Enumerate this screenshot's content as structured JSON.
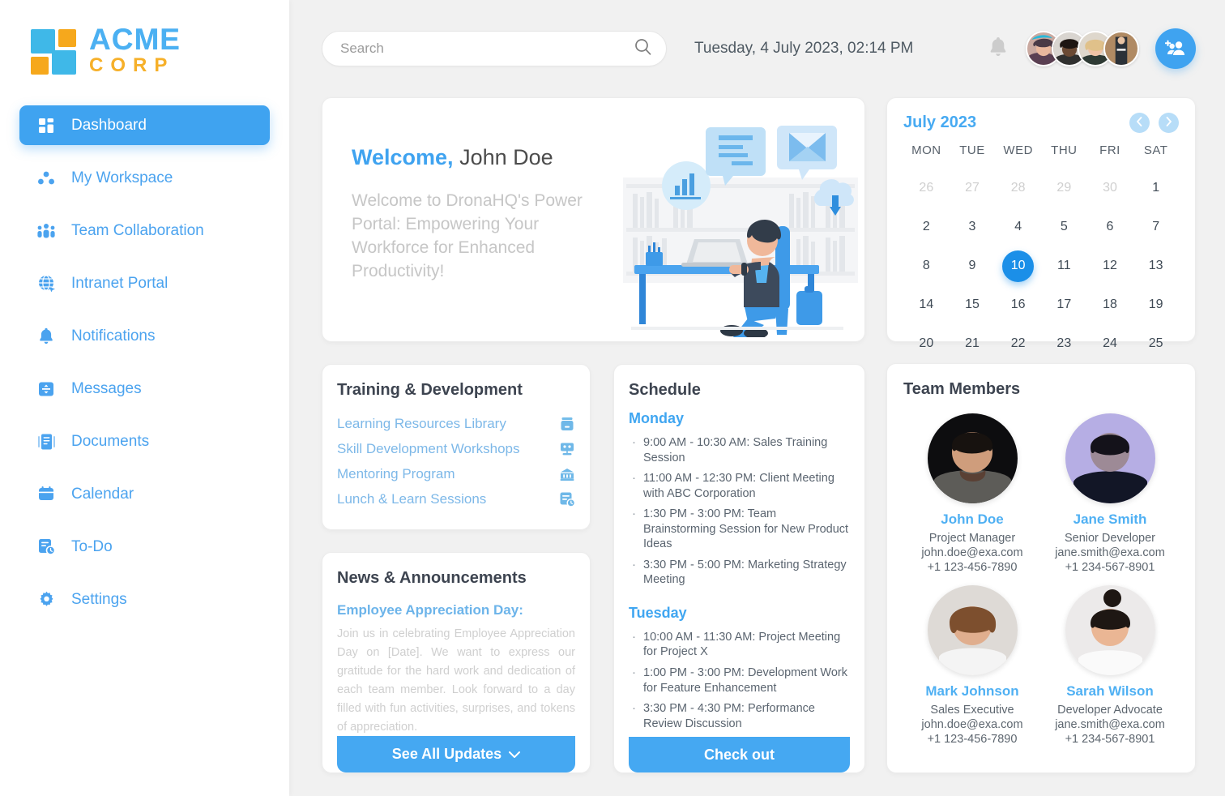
{
  "brand": {
    "name_primary": "ACME",
    "name_secondary": "CORP"
  },
  "sidebar": {
    "items": [
      {
        "label": "Dashboard",
        "icon": "grid-icon",
        "active": true
      },
      {
        "label": "My Workspace",
        "icon": "dots-group-icon",
        "active": false
      },
      {
        "label": "Team Collaboration",
        "icon": "people-icon",
        "active": false
      },
      {
        "label": "Intranet Portal",
        "icon": "globe-icon",
        "active": false
      },
      {
        "label": "Notifications",
        "icon": "bell-icon",
        "active": false
      },
      {
        "label": "Messages",
        "icon": "message-icon",
        "active": false
      },
      {
        "label": "Documents",
        "icon": "document-icon",
        "active": false
      },
      {
        "label": "Calendar",
        "icon": "calendar-icon",
        "active": false
      },
      {
        "label": "To-Do",
        "icon": "todo-icon",
        "active": false
      },
      {
        "label": "Settings",
        "icon": "gear-icon",
        "active": false
      }
    ]
  },
  "header": {
    "search": {
      "placeholder": "Search",
      "value": "",
      "icon": "search-icon"
    },
    "datetime": "Tuesday, 4 July 2023, 02:14 PM",
    "bell_icon": "bell-icon",
    "add_people_icon": "add-people-icon",
    "avatar_count": 4
  },
  "welcome": {
    "greeting": "Welcome,",
    "user": "John Doe",
    "message": "Welcome to DronaHQ's Power Portal: Empowering Your Workforce for Enhanced Productivity!",
    "illustration": "person-at-desk-illustration"
  },
  "training": {
    "title": "Training & Development",
    "items": [
      {
        "label": "Learning Resources Library",
        "icon": "archive-box-icon"
      },
      {
        "label": "Skill Development Workshops",
        "icon": "presentation-icon"
      },
      {
        "label": "Mentoring Program",
        "icon": "bank-icon"
      },
      {
        "label": "Lunch & Learn Sessions",
        "icon": "calendar-clock-icon"
      }
    ]
  },
  "news": {
    "title": "News & Announcements",
    "headline": "Employee Appreciation Day:",
    "body": "Join us in celebrating Employee Appreciation Day on [Date]. We want to express our gratitude for the hard work and dedication of each team member. Look forward to a day filled with fun activities, surprises, and tokens of appreciation.",
    "button_label": "See All Updates",
    "button_icon": "chevron-down-icon"
  },
  "schedule": {
    "title": "Schedule",
    "days": [
      {
        "name": "Monday",
        "events": [
          "9:00 AM - 10:30 AM: Sales Training Session",
          "11:00 AM - 12:30 PM: Client Meeting with ABC Corporation",
          "1:30 PM - 3:00 PM: Team Brainstorming Session for New Product Ideas",
          "3:30 PM - 5:00 PM: Marketing Strategy Meeting"
        ]
      },
      {
        "name": "Tuesday",
        "events": [
          "10:00 AM - 11:30 AM: Project Meeting for Project X",
          "1:00 PM - 3:00 PM: Development Work for Feature Enhancement",
          "3:30 PM - 4:30 PM: Performance Review Discussion"
        ]
      }
    ],
    "button_label": "Check out"
  },
  "calendar": {
    "month": "July 2023",
    "prev_icon": "chevron-left-icon",
    "next_icon": "chevron-right-icon",
    "dow": [
      "MON",
      "TUE",
      "WED",
      "THU",
      "FRI",
      "SAT"
    ],
    "weeks": [
      [
        {
          "d": "26",
          "muted": true
        },
        {
          "d": "27",
          "muted": true
        },
        {
          "d": "28",
          "muted": true
        },
        {
          "d": "29",
          "muted": true
        },
        {
          "d": "30",
          "muted": true
        },
        {
          "d": "1"
        }
      ],
      [
        {
          "d": "2"
        },
        {
          "d": "3"
        },
        {
          "d": "4"
        },
        {
          "d": "5"
        },
        {
          "d": "6"
        },
        {
          "d": "7"
        }
      ],
      [
        {
          "d": "8"
        },
        {
          "d": "9"
        },
        {
          "d": "10",
          "today": true
        },
        {
          "d": "11"
        },
        {
          "d": "12"
        },
        {
          "d": "13"
        }
      ],
      [
        {
          "d": "14"
        },
        {
          "d": "15"
        },
        {
          "d": "16"
        },
        {
          "d": "17"
        },
        {
          "d": "18"
        },
        {
          "d": "19"
        }
      ],
      [
        {
          "d": "20"
        },
        {
          "d": "21"
        },
        {
          "d": "22"
        },
        {
          "d": "23"
        },
        {
          "d": "24"
        },
        {
          "d": "25"
        }
      ]
    ]
  },
  "team": {
    "title": "Team Members",
    "members": [
      {
        "name": "John Doe",
        "role": "Project Manager",
        "email": "john.doe@exa.com",
        "phone": "+1 123-456-7890"
      },
      {
        "name": "Jane Smith",
        "role": "Senior Developer",
        "email": "jane.smith@exa.com",
        "phone": "+1 234-567-8901"
      },
      {
        "name": "Mark Johnson",
        "role": "Sales Executive",
        "email": "john.doe@exa.com",
        "phone": "+1 123-456-7890"
      },
      {
        "name": "Sarah Wilson",
        "role": "Developer Advocate",
        "email": "jane.smith@exa.com",
        "phone": "+1 234-567-8901"
      }
    ]
  },
  "colors": {
    "accent": "#3fa3f0",
    "accent_light": "#7db8e8",
    "brand_orange": "#f6b02a",
    "today": "#1b8fe8",
    "page_bg": "#f1f1f1"
  }
}
